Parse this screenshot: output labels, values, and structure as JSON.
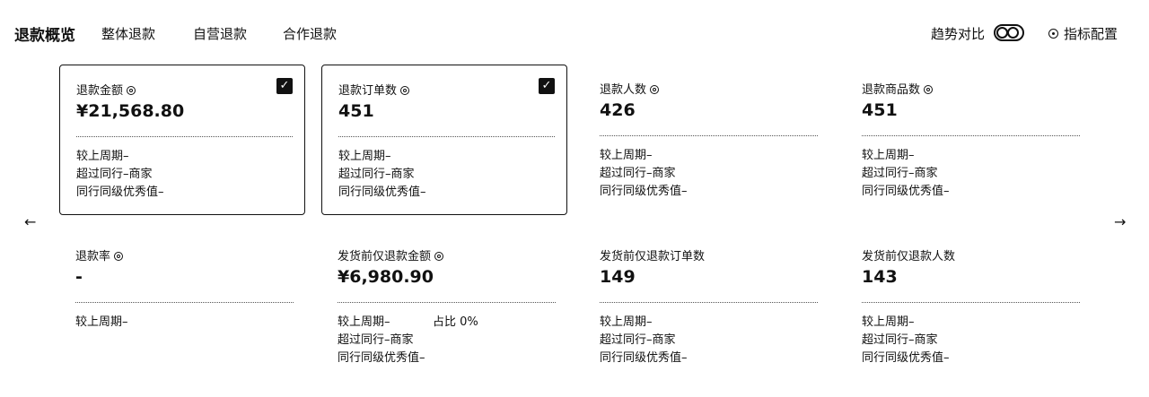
{
  "header": {
    "title": "退款概览",
    "tabs": [
      {
        "label": "整体退款"
      },
      {
        "label": "自营退款"
      },
      {
        "label": "合作退款"
      }
    ],
    "trend_label": "趋势对比",
    "config_label": "指标配置"
  },
  "nav": {
    "prev": "←",
    "next": "→"
  },
  "cards": [
    {
      "label": "退款金额",
      "value": "¥21,568.80",
      "checked": true,
      "check": "✓",
      "lines": [
        "较上周期–",
        "超过同行–商家",
        "同行同级优秀值–"
      ]
    },
    {
      "label": "退款订单数",
      "value": "451",
      "checked": true,
      "check": "✓",
      "lines": [
        "较上周期–",
        "超过同行–商家",
        "同行同级优秀值–"
      ]
    },
    {
      "label": "退款人数",
      "value": "426",
      "checked": false,
      "lines": [
        "较上周期–",
        "超过同行–商家",
        "同行同级优秀值–"
      ]
    },
    {
      "label": "退款商品数",
      "value": "451",
      "checked": false,
      "lines": [
        "较上周期–",
        "超过同行–商家",
        "同行同级优秀值–"
      ]
    },
    {
      "label": "退款率",
      "value": "-",
      "checked": false,
      "lines": [
        "较上周期–"
      ]
    },
    {
      "label": "发货前仅退款金额",
      "value": "¥6,980.90",
      "checked": false,
      "share": "占比 0%",
      "lines": [
        "较上周期–",
        "超过同行–商家",
        "同行同级优秀值–"
      ]
    },
    {
      "label": "发货前仅退款订单数",
      "value": "149",
      "checked": false,
      "lines": [
        "较上周期–",
        "超过同行–商家",
        "同行同级优秀值–"
      ]
    },
    {
      "label": "发货前仅退款人数",
      "value": "143",
      "checked": false,
      "lines": [
        "较上周期–",
        "超过同行–商家",
        "同行同级优秀值–"
      ]
    }
  ]
}
